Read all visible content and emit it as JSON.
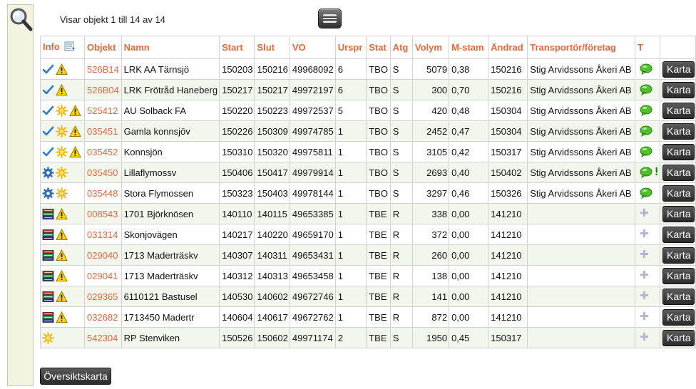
{
  "status_text": "Visar objekt 1 till 14 av 14",
  "headers": {
    "info": "Info",
    "objekt": "Objekt",
    "namn": "Namn",
    "start": "Start",
    "slut": "Slut",
    "vo": "VO",
    "urspr": "Urspr",
    "stat": "Stat",
    "atg": "Atg",
    "volym": "Volym",
    "mstam": "M-stam",
    "andrad": "Ändrad",
    "transportor": "Transportör/företag",
    "t": "T"
  },
  "karta_label": "Karta",
  "overview_label": "Översiktskarta",
  "colors": {
    "accent": "#e5683a",
    "row_alt": "#f2f6ec",
    "button_dark": "#2a2a2a"
  },
  "rows": [
    {
      "icons": [
        "check-icon",
        "warning-icon"
      ],
      "objekt": "526B14",
      "namn": "LRK AA Tärnsjö",
      "start": "150203",
      "slut": "150216",
      "vo": "49968092",
      "urspr": "6",
      "stat": "TBO",
      "atg": "S",
      "volym": "5079",
      "mstam": "0,38",
      "andrad": "150216",
      "transportor": "Stig Arvidssons Åkeri AB",
      "t": "comment-icon",
      "alert": ""
    },
    {
      "icons": [
        "check-icon",
        "warning-icon"
      ],
      "objekt": "526B04",
      "namn": "LRK Frötråd Haneberg",
      "start": "150217",
      "slut": "150217",
      "vo": "49972197",
      "urspr": "6",
      "stat": "TBO",
      "atg": "S",
      "volym": "300",
      "mstam": "0,70",
      "andrad": "150216",
      "transportor": "Stig Arvidssons Åkeri AB",
      "t": "comment-icon",
      "alert": ""
    },
    {
      "icons": [
        "check-icon",
        "sun-icon",
        "warning-icon"
      ],
      "objekt": "525412",
      "namn": "AU Solback FA",
      "start": "150220",
      "slut": "150223",
      "vo": "49972537",
      "urspr": "5",
      "stat": "TBO",
      "atg": "S",
      "volym": "420",
      "mstam": "0,48",
      "andrad": "150304",
      "transportor": "Stig Arvidssons Åkeri AB",
      "t": "comment-icon",
      "alert": ""
    },
    {
      "icons": [
        "check-icon",
        "sun-icon",
        "warning-icon"
      ],
      "objekt": "035451",
      "namn": "Gamla konnsjöv",
      "start": "150226",
      "slut": "150309",
      "vo": "49974785",
      "urspr": "1",
      "stat": "TBO",
      "atg": "S",
      "volym": "2452",
      "mstam": "0,47",
      "andrad": "150304",
      "transportor": "Stig Arvidssons Åkeri AB",
      "t": "comment-icon",
      "alert": ""
    },
    {
      "icons": [
        "check-icon",
        "sun-icon",
        "warning-icon"
      ],
      "objekt": "035452",
      "namn": "Konnsjön",
      "start": "150310",
      "slut": "150320",
      "vo": "49975811",
      "urspr": "1",
      "stat": "TBO",
      "atg": "S",
      "volym": "3105",
      "mstam": "0,42",
      "andrad": "150317",
      "transportor": "Stig Arvidssons Åkeri AB",
      "t": "comment-icon",
      "alert": ""
    },
    {
      "icons": [
        "gear-icon",
        "sun-icon"
      ],
      "objekt": "035450",
      "namn": "Lillaflymossv",
      "start": "150406",
      "slut": "150417",
      "vo": "49979914",
      "urspr": "1",
      "stat": "TBO",
      "atg": "S",
      "volym": "2693",
      "mstam": "0,40",
      "andrad": "150402",
      "transportor": "Stig Arvidssons Åkeri AB",
      "t": "comment-icon",
      "alert": "!"
    },
    {
      "icons": [
        "gear-icon",
        "sun-icon"
      ],
      "objekt": "035448",
      "namn": "Stora Flymossen",
      "start": "150323",
      "slut": "150403",
      "vo": "49978144",
      "urspr": "1",
      "stat": "TBO",
      "atg": "S",
      "volym": "3297",
      "mstam": "0,46",
      "andrad": "150326",
      "transportor": "Stig Arvidssons Åkeri AB",
      "t": "comment-icon",
      "alert": ""
    },
    {
      "icons": [
        "books-icon",
        "warning-icon"
      ],
      "objekt": "008543",
      "namn": "1701 Björknösen",
      "start": "140110",
      "slut": "140115",
      "vo": "49653385",
      "urspr": "1",
      "stat": "TBE",
      "atg": "R",
      "volym": "338",
      "mstam": "0,00",
      "andrad": "141210",
      "transportor": "",
      "t": "plus-icon",
      "alert": ""
    },
    {
      "icons": [
        "books-icon",
        "warning-icon"
      ],
      "objekt": "031314",
      "namn": "Skonjovägen",
      "start": "140217",
      "slut": "140220",
      "vo": "49659170",
      "urspr": "1",
      "stat": "TBE",
      "atg": "R",
      "volym": "372",
      "mstam": "0,00",
      "andrad": "141210",
      "transportor": "",
      "t": "plus-icon",
      "alert": ""
    },
    {
      "icons": [
        "books-icon",
        "warning-icon"
      ],
      "objekt": "029040",
      "namn": "1713 Maderträskv",
      "start": "140307",
      "slut": "140311",
      "vo": "49653431",
      "urspr": "1",
      "stat": "TBE",
      "atg": "R",
      "volym": "260",
      "mstam": "0,00",
      "andrad": "141210",
      "transportor": "",
      "t": "plus-icon",
      "alert": ""
    },
    {
      "icons": [
        "books-icon",
        "warning-icon"
      ],
      "objekt": "029041",
      "namn": "1713 Maderträskv",
      "start": "140312",
      "slut": "140313",
      "vo": "49653458",
      "urspr": "1",
      "stat": "TBE",
      "atg": "R",
      "volym": "138",
      "mstam": "0,00",
      "andrad": "141210",
      "transportor": "",
      "t": "plus-icon",
      "alert": ""
    },
    {
      "icons": [
        "books-icon",
        "warning-icon"
      ],
      "objekt": "029365",
      "namn": "6110121 Bastusel",
      "start": "140530",
      "slut": "140602",
      "vo": "49672746",
      "urspr": "1",
      "stat": "TBE",
      "atg": "R",
      "volym": "141",
      "mstam": "0,00",
      "andrad": "141210",
      "transportor": "",
      "t": "plus-icon",
      "alert": ""
    },
    {
      "icons": [
        "books-icon",
        "warning-icon"
      ],
      "objekt": "032682",
      "namn": "1713450 Madertr",
      "start": "140604",
      "slut": "140617",
      "vo": "49672762",
      "urspr": "1",
      "stat": "TBE",
      "atg": "R",
      "volym": "872",
      "mstam": "0,00",
      "andrad": "141210",
      "transportor": "",
      "t": "plus-icon",
      "alert": ""
    },
    {
      "icons": [
        "sun-icon"
      ],
      "objekt": "542304",
      "namn": "RP Stenviken",
      "start": "150526",
      "slut": "150602",
      "vo": "49971174",
      "urspr": "2",
      "stat": "TBE",
      "atg": "S",
      "volym": "1950",
      "mstam": "0,45",
      "andrad": "150317",
      "transportor": "",
      "t": "plus-icon",
      "alert": ""
    }
  ]
}
